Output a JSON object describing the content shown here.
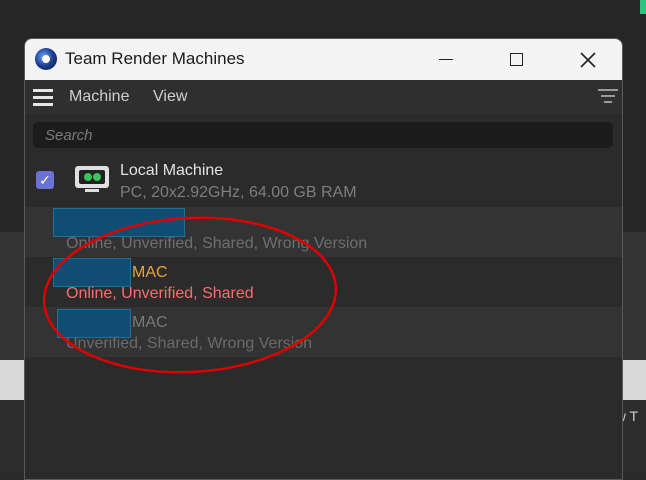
{
  "window": {
    "title": "Team Render Machines"
  },
  "menu": {
    "machine": "Machine",
    "view": "View"
  },
  "search": {
    "placeholder": "Search"
  },
  "machines": [
    {
      "name": "Local Machine",
      "details": "PC, 20x2.92GHz, 64.00 GB RAM",
      "checked": true,
      "status_color": "#7e7e7e"
    },
    {
      "name": "",
      "details": "Online, Unverified, Shared, Wrong Version",
      "status_color": "#6f6f6f"
    },
    {
      "name": "MAC",
      "details": "Online, Unverified, Shared",
      "name_color": "#e8a33d",
      "status_color": "#ff6b6b"
    },
    {
      "name": "MAC",
      "details": "Unverified, Shared, Wrong Version",
      "status_color": "#6a6a6a"
    }
  ],
  "background": {
    "partial_text": "ew T"
  },
  "colors": {
    "accent": "#6a72d6",
    "annotation": "#e00000",
    "redaction": "#0f4d73"
  },
  "icons": [
    "app-logo-icon",
    "minimize-icon",
    "maximize-icon",
    "close-icon",
    "hamburger-menu-icon",
    "filter-icon",
    "checkbox-check-icon",
    "computer-monitor-icon"
  ]
}
